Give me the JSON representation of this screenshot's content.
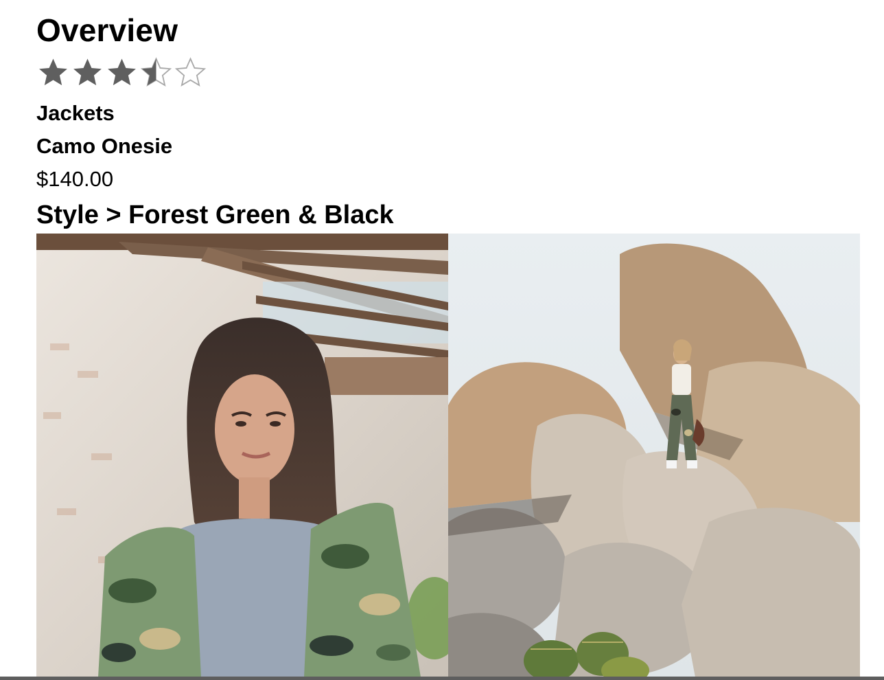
{
  "overview": {
    "title": "Overview",
    "rating": {
      "value": 3.5,
      "max": 5,
      "filled_color": "#5f5f5f",
      "empty_color": "#a9a9a9"
    }
  },
  "product": {
    "category": "Jackets",
    "name": "Camo Onesie",
    "price": "$140.00",
    "style_label": "Style > Forest Green & Black"
  },
  "gallery": {
    "images": [
      {
        "description": "woman-in-camo-jacket-photo"
      },
      {
        "description": "woman-standing-on-rocks-photo"
      }
    ]
  }
}
